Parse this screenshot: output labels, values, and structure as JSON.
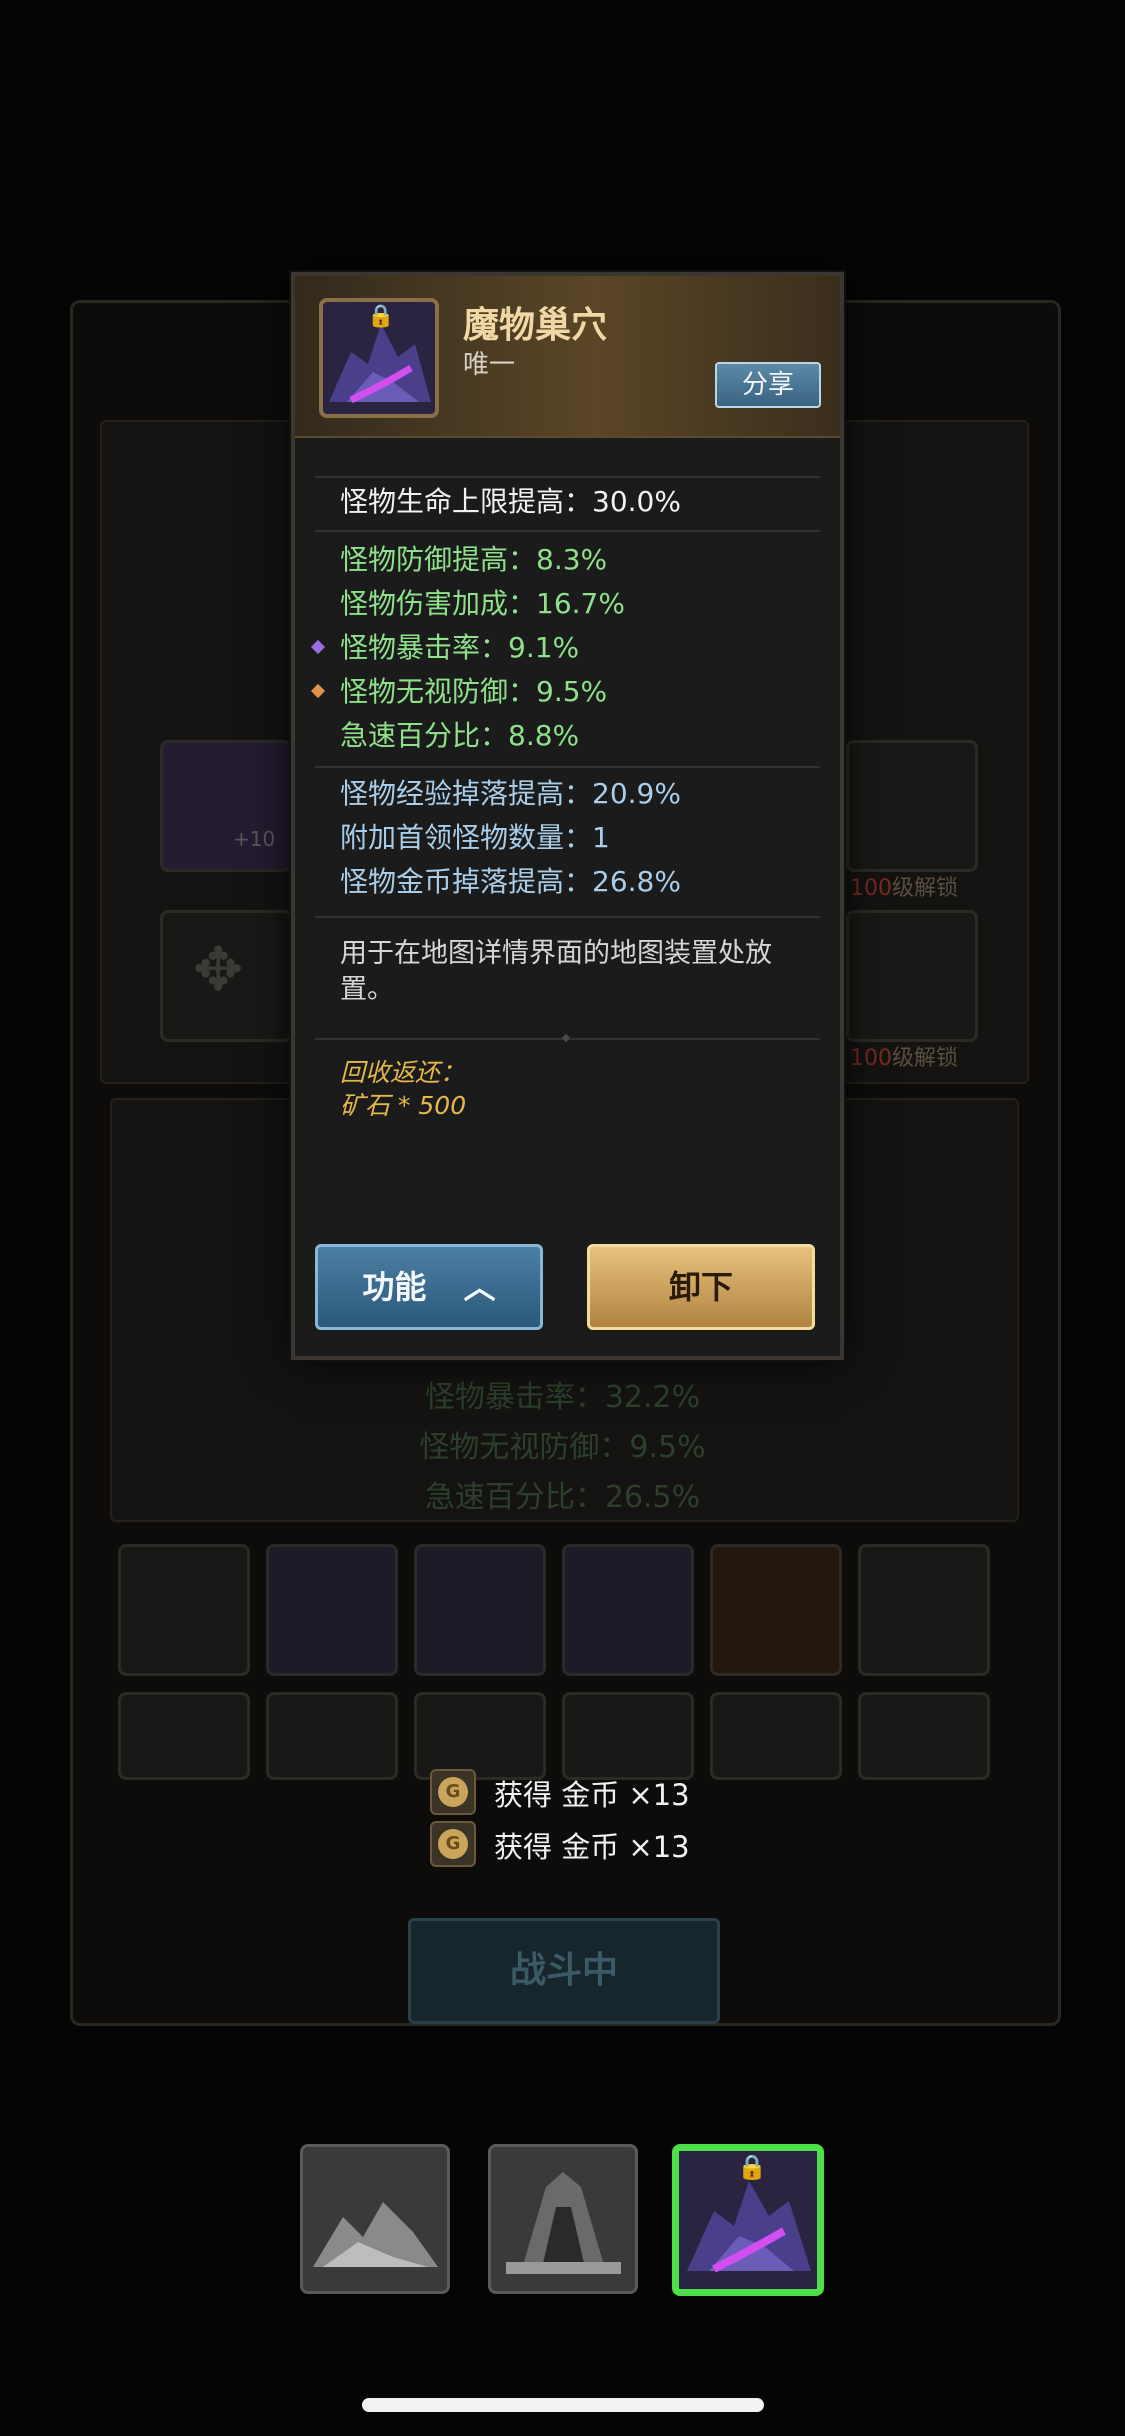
{
  "item": {
    "name": "魔物巢穴",
    "rarity": "唯一",
    "share_label": "分享"
  },
  "stats": {
    "base": "怪物生命上限提高：30.0%",
    "green": [
      "怪物防御提高：8.3%",
      "怪物伤害加成：16.7%",
      "怪物暴击率：9.1%",
      "怪物无视防御：9.5%",
      "急速百分比：8.8%"
    ],
    "blue": [
      "怪物经验掉落提高：20.9%",
      "附加首领怪物数量：1",
      "怪物金币掉落提高：26.8%"
    ],
    "bullet_colors": {
      "crit": "#9b6be0",
      "ignore_def": "#e0904a"
    }
  },
  "description": "用于在地图详情界面的地图装置处放置。",
  "recycle": {
    "title": "回收返还：",
    "value": "矿石 * 500"
  },
  "buttons": {
    "function_label": "功能",
    "unequip_label": "卸下"
  },
  "background": {
    "lock_level": "100",
    "lock_suffix": "级解锁",
    "plus_badge": "+10",
    "summary": [
      "怪物暴击率：32.2%",
      "怪物无视防御：9.5%",
      "急速百分比：26.5%"
    ],
    "battle_label": "战斗中"
  },
  "toasts": [
    {
      "text": "获得 金币 ×13"
    },
    {
      "text": "获得 金币 ×13"
    }
  ],
  "colors": {
    "accent_green": "#4ee04a",
    "gold": "#e2b84a",
    "stat_green": "#8fe08a",
    "stat_blue": "#a9cde8"
  }
}
